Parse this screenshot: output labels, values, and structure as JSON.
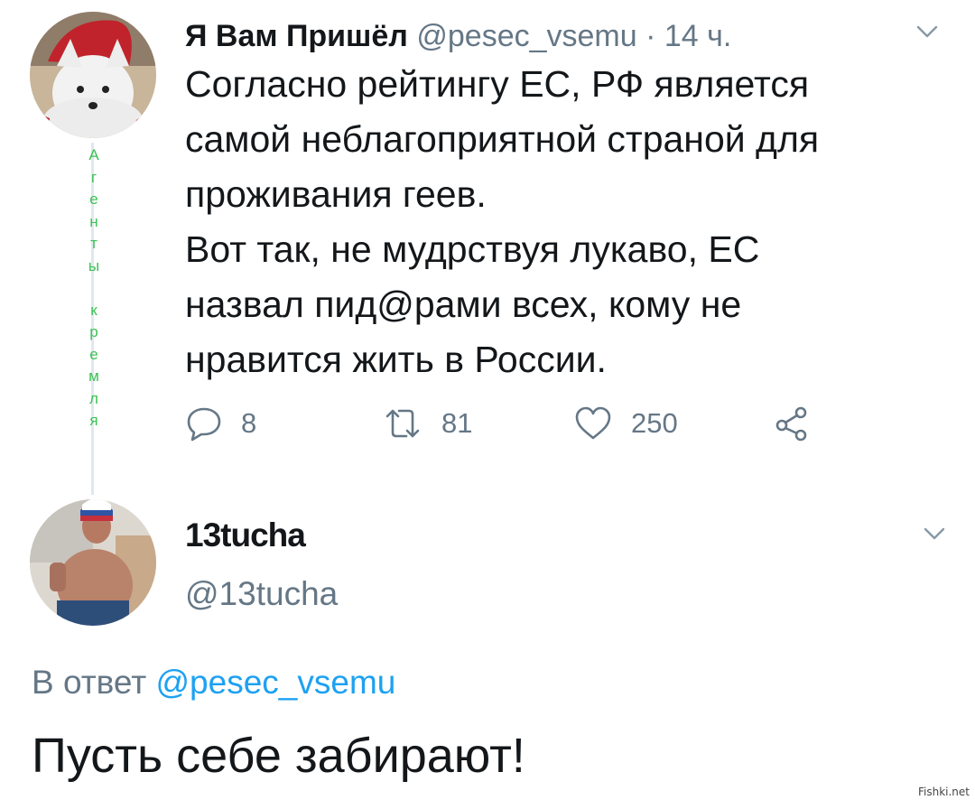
{
  "tweet": {
    "author_name": "Я Вам Пришёл",
    "author_handle": "@pesec_vsemu",
    "separator": "·",
    "time": "14 ч.",
    "text_lines": [
      "Согласно рейтингу ЕС, РФ является",
      "самой неблагоприятной страной для",
      "проживания геев.",
      "Вот так, не мудрствуя лукаво, ЕС",
      "назвал пид@рами всех, кому не",
      "нравится жить в России."
    ],
    "reply_count": "8",
    "retweet_count": "81",
    "like_count": "250"
  },
  "side_caption_letters": [
    "А",
    "г",
    "е",
    "н",
    "т",
    "ы",
    "",
    "к",
    "р",
    "е",
    "м",
    "л",
    "я"
  ],
  "reply": {
    "author_name": "13tucha",
    "author_handle": "@13tucha",
    "reply_prefix": "В ответ",
    "reply_mention": "@pesec_vsemu",
    "text": "Пусть себе забирают!"
  },
  "watermark": "Fishki.net",
  "icons": {
    "more": "chevron-down-icon",
    "reply": "comment-bubble-icon",
    "retweet": "retweet-icon",
    "like": "heart-icon",
    "share": "share-icon"
  },
  "colors": {
    "text": "#14171a",
    "secondary": "#657786",
    "link": "#1da1f2",
    "caption": "#3cc155"
  }
}
